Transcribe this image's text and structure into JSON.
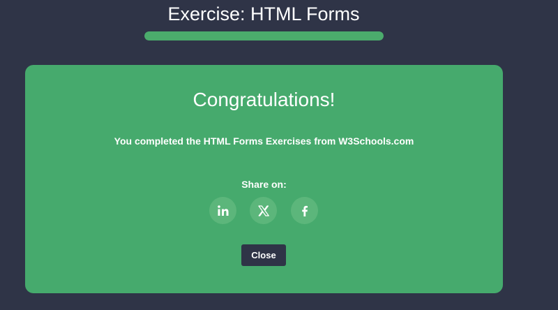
{
  "header": {
    "title": "Exercise: HTML Forms",
    "progress": 1.0
  },
  "modal": {
    "heading": "Congratulations!",
    "message": "You completed the HTML Forms Exercises from W3Schools.com",
    "share_label": "Share on:",
    "share_buttons": [
      {
        "icon": "linkedin-icon"
      },
      {
        "icon": "x-icon"
      },
      {
        "icon": "facebook-icon"
      }
    ],
    "close_label": "Close"
  },
  "colors": {
    "background": "#2f3447",
    "card": "#46aa6d",
    "progress_fill": "#4bab6c",
    "share_button": "#5cb67b",
    "close_button": "#2f3447",
    "text": "#ffffff"
  }
}
